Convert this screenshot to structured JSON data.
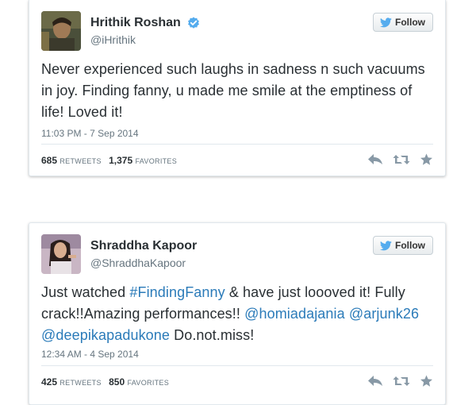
{
  "tweets": [
    {
      "name": "Hrithik Roshan",
      "handle": "@iHrithik",
      "verified": true,
      "follow_label": "Follow",
      "text_parts": [
        {
          "text": "Never experienced such laughs in sadness n such vacuums in joy. Finding fanny, u made me smile at the emptiness of life! Loved it!",
          "link": false
        }
      ],
      "timestamp": "11:03 PM - 7 Sep 2014",
      "retweets": "685",
      "retweets_label": "RETWEETS",
      "favorites": "1,375",
      "favorites_label": "FAVORITES"
    },
    {
      "name": "Shraddha Kapoor",
      "handle": "@ShraddhaKapoor",
      "verified": false,
      "follow_label": "Follow",
      "text_parts": [
        {
          "text": "Just watched ",
          "link": false
        },
        {
          "text": "#FindingFanny",
          "link": true
        },
        {
          "text": " & have just loooved it! Fully crack!!Amazing performances!! ",
          "link": false
        },
        {
          "text": "@homiadajania",
          "link": true
        },
        {
          "text": " ",
          "link": false
        },
        {
          "text": "@arjunk26",
          "link": true
        },
        {
          "text": " ",
          "link": false
        },
        {
          "text": "@deepikapadukone",
          "link": true
        },
        {
          "text": " Do.not.miss!",
          "link": false
        }
      ],
      "timestamp": "12:34 AM - 4 Sep 2014",
      "retweets": "425",
      "retweets_label": "RETWEETS",
      "favorites": "850",
      "favorites_label": "FAVORITES"
    }
  ],
  "colors": {
    "link": "#2b7bb9",
    "verified": "#55acee",
    "twitter_bird": "#55acee",
    "muted": "#66757f"
  },
  "icons": [
    "verified-badge-icon",
    "twitter-bird-icon",
    "reply-icon",
    "retweet-icon",
    "favorite-star-icon"
  ]
}
